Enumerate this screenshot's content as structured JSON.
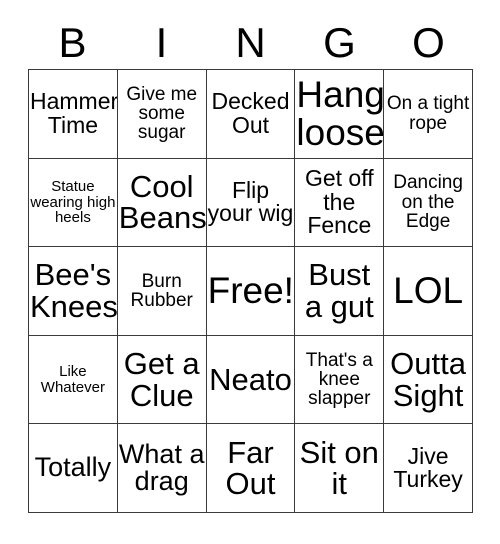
{
  "header": {
    "letters": [
      "B",
      "I",
      "N",
      "G",
      "O"
    ]
  },
  "colors": {
    "border": "#3a3a3a",
    "text": "#000000",
    "background": "#ffffff"
  },
  "grid": {
    "rows": 5,
    "columns": 5,
    "cells": [
      [
        {
          "text": "Hammer Time",
          "size": "fs-m"
        },
        {
          "text": "Give me some sugar",
          "size": "fs-s"
        },
        {
          "text": "Decked Out",
          "size": "fs-m"
        },
        {
          "text": "Hang loose",
          "size": "fs-xxl"
        },
        {
          "text": "On a tight rope",
          "size": "fs-s"
        }
      ],
      [
        {
          "text": "Statue wearing high heels",
          "size": "fs-xs"
        },
        {
          "text": "Cool Beans",
          "size": "fs-xl"
        },
        {
          "text": "Flip your wig",
          "size": "fs-m"
        },
        {
          "text": "Get off the Fence",
          "size": "fs-m"
        },
        {
          "text": "Dancing on the Edge",
          "size": "fs-s"
        }
      ],
      [
        {
          "text": "Bee's Knees",
          "size": "fs-xl"
        },
        {
          "text": "Burn Rubber",
          "size": "fs-s"
        },
        {
          "text": "Free!",
          "size": "fs-xxl"
        },
        {
          "text": "Bust a gut",
          "size": "fs-xl"
        },
        {
          "text": "LOL",
          "size": "fs-xxl"
        }
      ],
      [
        {
          "text": "Like Whatever",
          "size": "fs-xs"
        },
        {
          "text": "Get a Clue",
          "size": "fs-xl"
        },
        {
          "text": "Neato",
          "size": "fs-xl"
        },
        {
          "text": "That's a knee slapper",
          "size": "fs-s"
        },
        {
          "text": "Outta Sight",
          "size": "fs-xl"
        }
      ],
      [
        {
          "text": "Totally",
          "size": "fs-l"
        },
        {
          "text": "What a drag",
          "size": "fs-l"
        },
        {
          "text": "Far Out",
          "size": "fs-xl"
        },
        {
          "text": "Sit on it",
          "size": "fs-xl"
        },
        {
          "text": "Jive Turkey",
          "size": "fs-m"
        }
      ]
    ]
  }
}
